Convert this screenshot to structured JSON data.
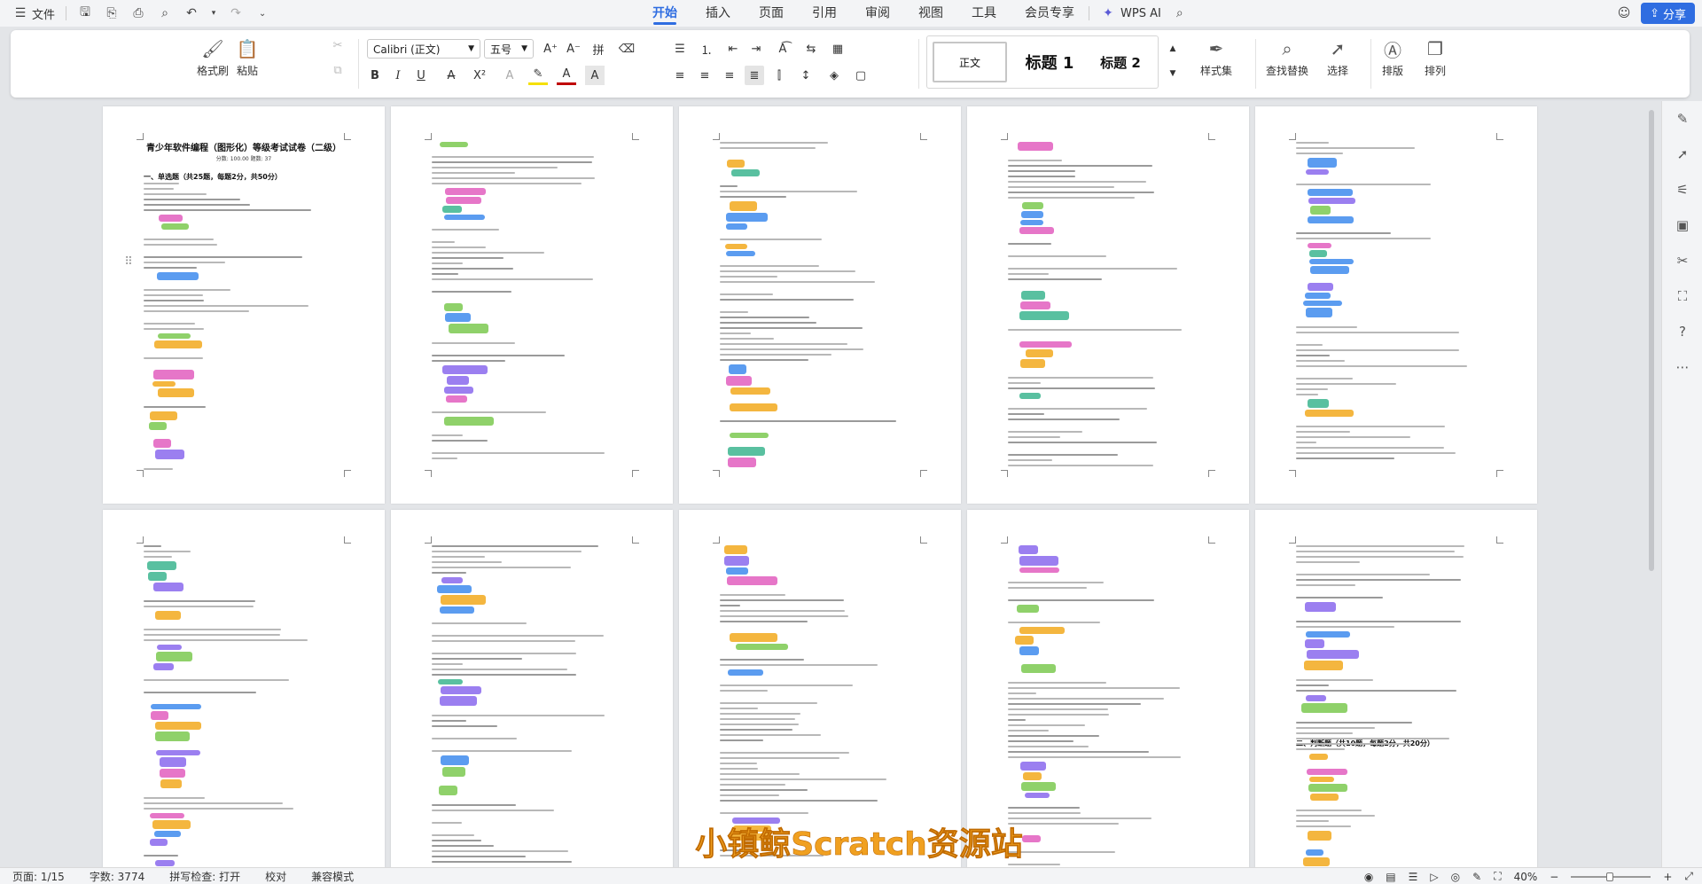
{
  "topbar": {
    "file_label": "文件",
    "tabs": [
      {
        "label": "开始",
        "active": true
      },
      {
        "label": "插入",
        "active": false
      },
      {
        "label": "页面",
        "active": false
      },
      {
        "label": "引用",
        "active": false
      },
      {
        "label": "审阅",
        "active": false
      },
      {
        "label": "视图",
        "active": false
      },
      {
        "label": "工具",
        "active": false
      },
      {
        "label": "会员专享",
        "active": false
      }
    ],
    "wps_ai_label": "WPS AI",
    "share_label": "分享",
    "accent_color": "#2f6de1"
  },
  "ribbon": {
    "format_painter_label": "格式刷",
    "paste_label": "粘贴",
    "font_name": "Calibri (正文)",
    "font_size": "五号",
    "styles": [
      "正文",
      "标题 1",
      "标题 2"
    ],
    "style_set_label": "样式集",
    "find_replace_label": "查找替换",
    "select_label": "选择",
    "layout_label": "排版",
    "arrange_label": "排列"
  },
  "document": {
    "title": "青少年软件编程（图形化）等级考试试卷（二级）",
    "subtitle": "分数: 100.00     题数: 37",
    "section1": "一、单选题（共25题，每题2分，共50分）",
    "section2": "二、判断题（共10题，每题2分，共20分）"
  },
  "watermark": {
    "text": "小镇鲸Scratch资源站",
    "color": "#f0a020"
  },
  "statusbar": {
    "page": "页面: 1/15",
    "words": "字数: 3774",
    "spellcheck": "拼写检查: 打开",
    "proofread": "校对",
    "compat": "兼容模式",
    "zoom": "40%"
  }
}
